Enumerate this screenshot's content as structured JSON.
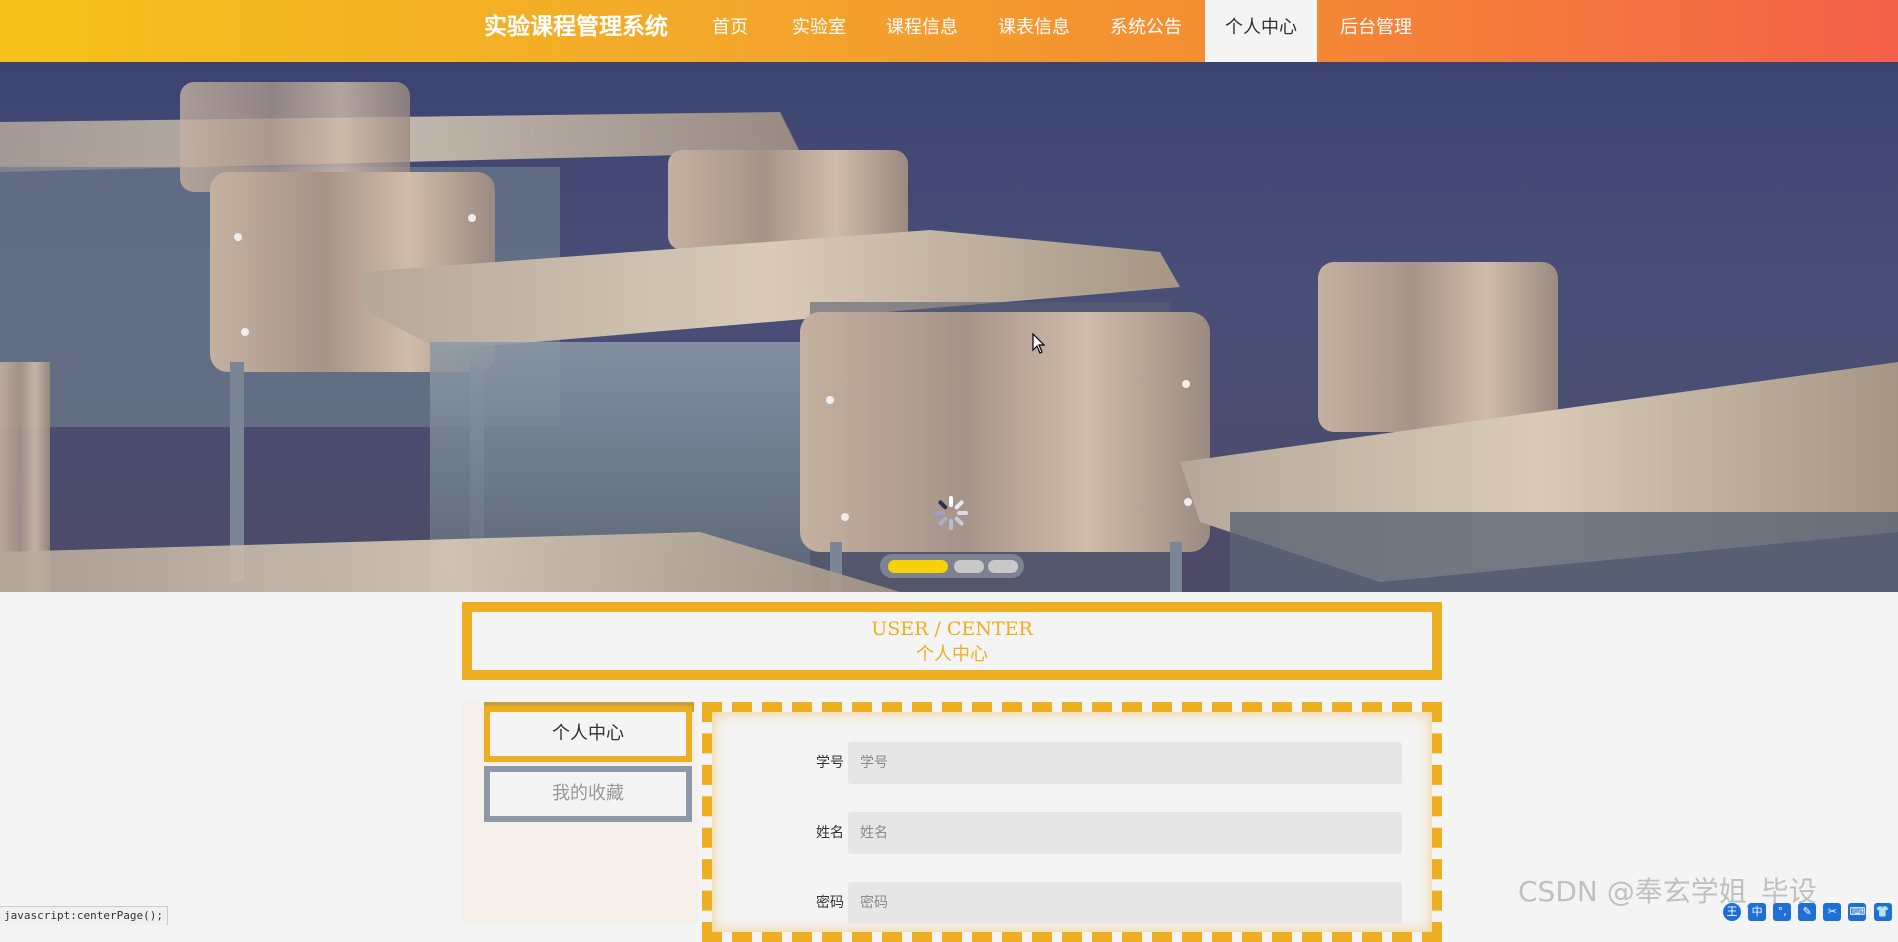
{
  "nav": {
    "brand": "实验课程管理系统",
    "items": [
      {
        "label": "首页"
      },
      {
        "label": "实验室"
      },
      {
        "label": "课程信息"
      },
      {
        "label": "课表信息"
      },
      {
        "label": "系统公告"
      },
      {
        "label": "个人中心",
        "active": true
      },
      {
        "label": "后台管理"
      }
    ]
  },
  "banner": {
    "slides": 3,
    "active_slide": 1,
    "loading_icon": "spinner-icon"
  },
  "section_title": {
    "en": "USER / CENTER",
    "cn": "个人中心"
  },
  "side_menu": {
    "items": [
      {
        "label": "个人中心",
        "active": true
      },
      {
        "label": "我的收藏",
        "active": false
      }
    ]
  },
  "form": {
    "fields": [
      {
        "label": "学号",
        "placeholder": "学号",
        "value": ""
      },
      {
        "label": "姓名",
        "placeholder": "姓名",
        "value": ""
      },
      {
        "label": "密码",
        "placeholder": "密码",
        "value": ""
      }
    ]
  },
  "status_bar": "javascript:centerPage();",
  "watermark": "CSDN @奉玄学姐_毕设",
  "ime_toolbar": {
    "icons": [
      "ime-logo-icon",
      "chinese-mode-icon",
      "punctuation-icon",
      "handwriting-icon",
      "tools-icon",
      "keyboard-icon",
      "skin-icon"
    ],
    "glyphs": [
      "王",
      "中",
      "°,",
      "✎",
      "✂",
      "⌨",
      "👕"
    ]
  },
  "colors": {
    "accent": "#eeae22",
    "nav_gradient_start": "#f5c21b",
    "nav_gradient_end": "#f4604a",
    "dot_active": "#f5d20b",
    "side_inactive_border": "#8e98a8"
  }
}
